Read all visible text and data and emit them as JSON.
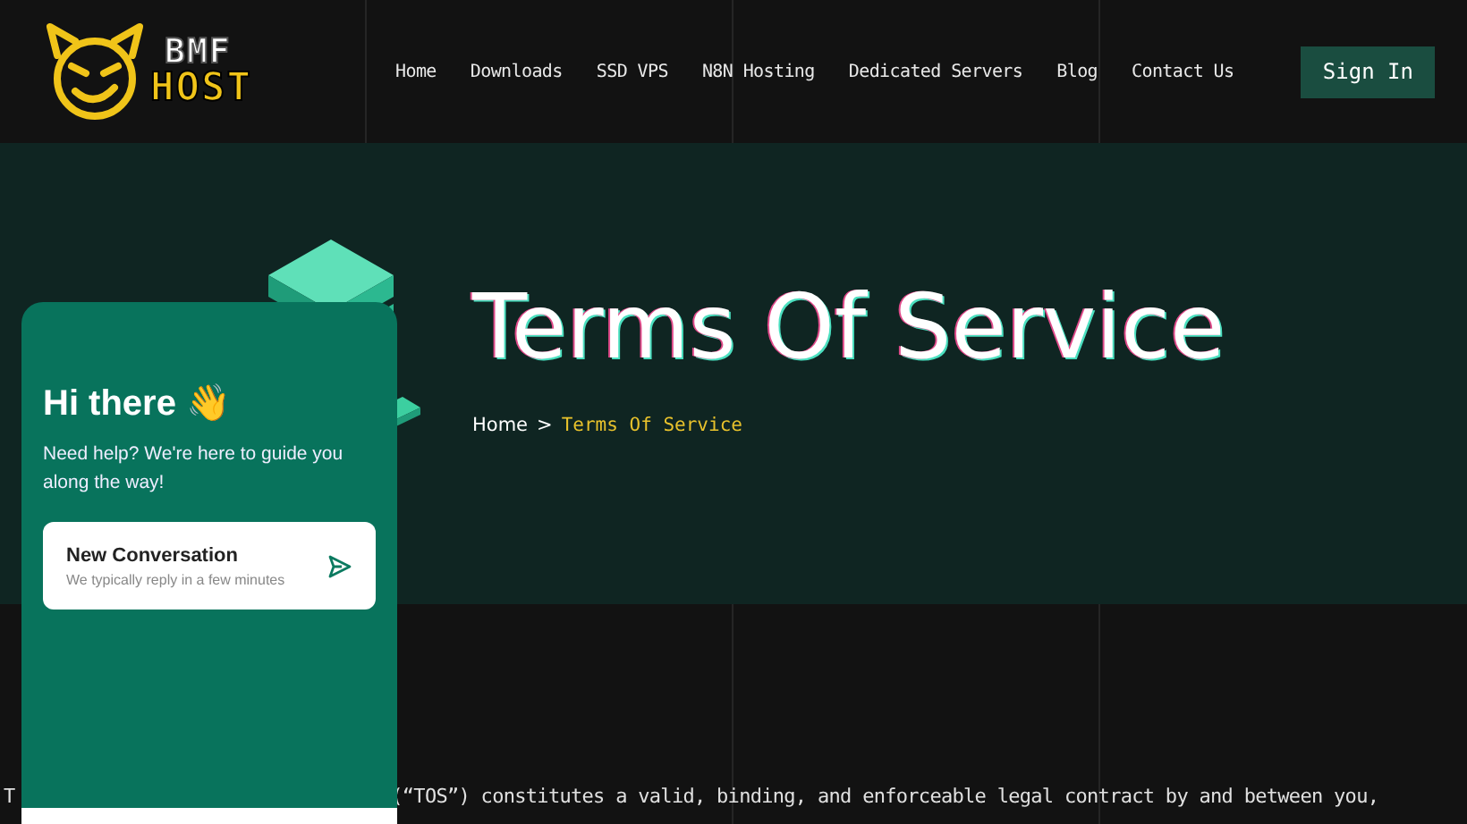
{
  "header": {
    "logo": {
      "line_1": "BMF",
      "line_2": "HOST"
    },
    "nav": [
      {
        "label": "Home"
      },
      {
        "label": "Downloads"
      },
      {
        "label": "SSD VPS"
      },
      {
        "label": "N8N Hosting"
      },
      {
        "label": "Dedicated Servers"
      },
      {
        "label": "Blog"
      },
      {
        "label": "Contact Us"
      }
    ],
    "sign_in": "Sign In"
  },
  "hero": {
    "title": "Terms Of Service",
    "breadcrumb": [
      {
        "label": "Home",
        "current": false
      },
      {
        "label": ">",
        "current": false
      },
      {
        "label": "Terms Of Service",
        "current": true
      }
    ]
  },
  "body": {
    "text_left": "T",
    "text_right": "(“TOS”) constitutes a valid, binding, and enforceable legal contract by and between you,"
  },
  "chat_widget": {
    "greeting": "Hi there 👋",
    "subtitle": "Need help? We're here to guide you along the way!",
    "card": {
      "title": "New Conversation",
      "subtitle": "We typically reply in a few minutes"
    }
  }
}
